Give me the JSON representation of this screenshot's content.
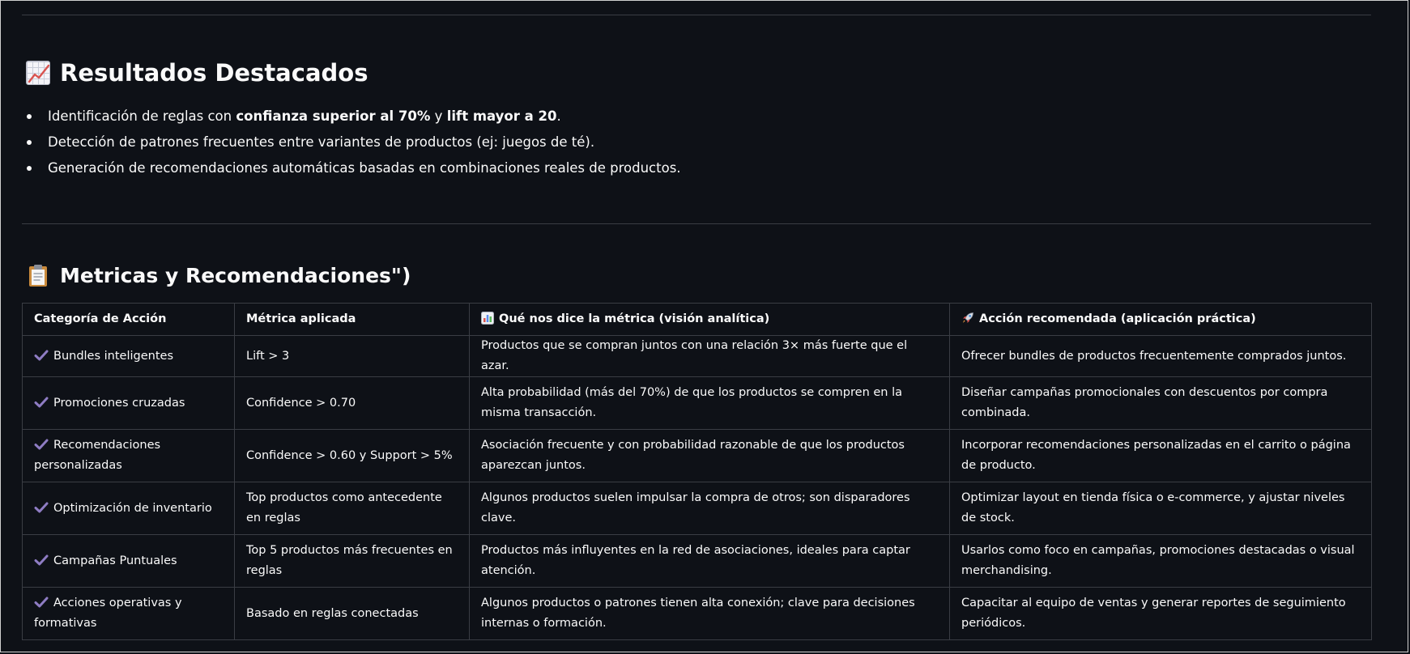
{
  "section1": {
    "title": "Resultados Destacados",
    "icon": "chart-increasing-icon",
    "bullets": [
      {
        "pre": "Identificación de reglas con ",
        "bold1": "confianza superior al 70%",
        "mid": " y ",
        "bold2": "lift mayor a 20",
        "post": "."
      },
      {
        "text": "Detección de patrones frecuentes entre variantes de productos (ej: juegos de té)."
      },
      {
        "text": "Generación de recomendaciones automáticas basadas en combinaciones reales de productos."
      }
    ]
  },
  "section2": {
    "title": "Metricas y Recomendaciones\")",
    "icon": "clipboard-icon"
  },
  "table": {
    "headers": {
      "categoria": "Categoría de Acción",
      "metrica": "Métrica aplicada",
      "vision": "Qué nos dice la métrica (visión analítica)",
      "accion": "Acción recomendada (aplicación práctica)"
    },
    "header_icons": {
      "vision": "bar-chart-icon",
      "accion": "rocket-icon"
    },
    "row_icon": "check-mark-icon",
    "rows": [
      {
        "categoria": "Bundles inteligentes",
        "metrica": "Lift > 3",
        "vision": "Productos que se compran juntos con una relación 3× más fuerte que el azar.",
        "accion": "Ofrecer bundles de productos frecuentemente comprados juntos."
      },
      {
        "categoria": "Promociones cruzadas",
        "metrica": "Confidence > 0.70",
        "vision": "Alta probabilidad (más del 70%) de que los productos se compren en la misma transacción.",
        "accion": "Diseñar campañas promocionales con descuentos por compra combinada."
      },
      {
        "categoria": "Recomendaciones personalizadas",
        "metrica": "Confidence > 0.60 y Support > 5%",
        "vision": "Asociación frecuente y con probabilidad razonable de que los productos aparezcan juntos.",
        "accion": "Incorporar recomendaciones personalizadas en el carrito o página de producto."
      },
      {
        "categoria": "Optimización de inventario",
        "metrica": "Top productos como antecedente en reglas",
        "vision": "Algunos productos suelen impulsar la compra de otros; son disparadores clave.",
        "accion": "Optimizar layout en tienda física o e-commerce, y ajustar niveles de stock."
      },
      {
        "categoria": "Campañas Puntuales",
        "metrica": "Top 5 productos más frecuentes en reglas",
        "vision": "Productos más influyentes en la red de asociaciones, ideales para captar atención.",
        "accion": "Usarlos como foco en campañas, promociones destacadas o visual merchandising."
      },
      {
        "categoria": "Acciones operativas y formativas",
        "metrica": "Basado en reglas conectadas",
        "vision": "Algunos productos o patrones tienen alta conexión; clave para decisiones internas o formación.",
        "accion": "Capacitar al equipo de ventas y generar reportes de seguimiento periódicos."
      }
    ]
  },
  "colors": {
    "background": "#0e1117",
    "text": "#fafafa",
    "border": "#3a3d44",
    "check": "#8e7cc3"
  }
}
